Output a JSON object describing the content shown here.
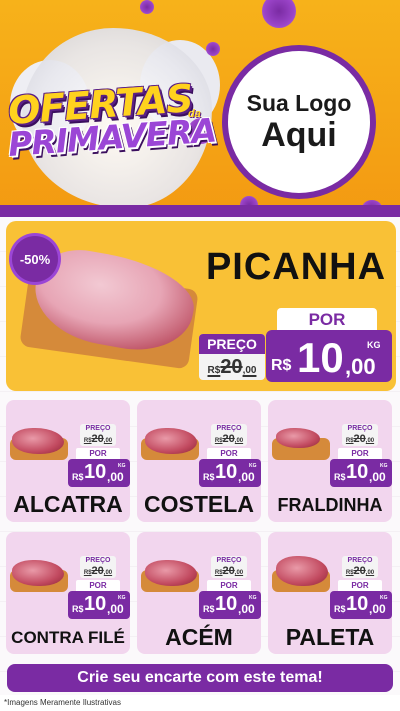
{
  "header": {
    "promo_line1": "OFERTAS",
    "promo_da": "da",
    "promo_line2": "PRIMAVERA",
    "logo_line1": "Sua Logo",
    "logo_line2": "Aqui"
  },
  "hero": {
    "discount": "-50%",
    "name": "PICANHA",
    "preco_label": "PREÇO",
    "old_currency": "R$",
    "old_int": "20",
    "old_cents": ",00",
    "por_label": "POR",
    "currency": "R$",
    "price_int": "10",
    "price_cents": ",00",
    "unit": "KG"
  },
  "products": [
    {
      "name": "ALCATRA",
      "preco_label": "PREÇO",
      "old_currency": "R$",
      "old_int": "20",
      "old_cents": ",00",
      "por_label": "POR",
      "currency": "R$",
      "price_int": "10",
      "price_cents": ",00",
      "unit": "KG"
    },
    {
      "name": "COSTELA",
      "preco_label": "PREÇO",
      "old_currency": "R$",
      "old_int": "20",
      "old_cents": ",00",
      "por_label": "POR",
      "currency": "R$",
      "price_int": "10",
      "price_cents": ",00",
      "unit": "KG"
    },
    {
      "name": "FRALDINHA",
      "preco_label": "PREÇO",
      "old_currency": "R$",
      "old_int": "20",
      "old_cents": ",00",
      "por_label": "POR",
      "currency": "R$",
      "price_int": "10",
      "price_cents": ",00",
      "unit": "KG"
    },
    {
      "name": "CONTRA FILÉ",
      "preco_label": "PREÇO",
      "old_currency": "R$",
      "old_int": "20",
      "old_cents": ",00",
      "por_label": "POR",
      "currency": "R$",
      "price_int": "10",
      "price_cents": ",00",
      "unit": "KG"
    },
    {
      "name": "ACÉM",
      "preco_label": "PREÇO",
      "old_currency": "R$",
      "old_int": "20",
      "old_cents": ",00",
      "por_label": "POR",
      "currency": "R$",
      "price_int": "10",
      "price_cents": ",00",
      "unit": "KG"
    },
    {
      "name": "PALETA",
      "preco_label": "PREÇO",
      "old_currency": "R$",
      "old_int": "20",
      "old_cents": ",00",
      "por_label": "POR",
      "currency": "R$",
      "price_int": "10",
      "price_cents": ",00",
      "unit": "KG"
    }
  ],
  "footer": {
    "cta": "Crie seu encarte com este tema!",
    "disclaimer": "*Imagens Meramente Ilustrativas"
  },
  "colors": {
    "brand_purple": "#7a2ba3",
    "header_orange": "#f7b21a",
    "hero_yellow": "#f9c136",
    "card_pink": "#f2d6ee"
  }
}
